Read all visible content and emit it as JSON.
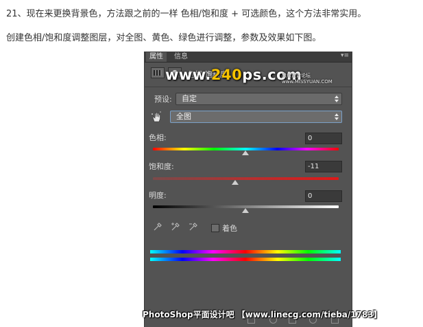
{
  "article": {
    "line1": "21、现在来更换背景色，方法跟之前的一样 色相/饱和度 + 可选颜色，这个方法非常实用。",
    "line2": "创建色相/饱和度调整图层，对全图、黄色、绿色进行调整，参数及效果如下图。"
  },
  "panel": {
    "tabs": [
      "属性",
      "信息"
    ],
    "menu_glyph": "▾≡",
    "title": "色相/饱和度",
    "preset_label": "预设:",
    "preset_value": "自定",
    "range_value": "全图",
    "hue_label": "色相:",
    "hue_value": "0",
    "saturation_label": "饱和度:",
    "saturation_value": "-11",
    "lightness_label": "明度:",
    "lightness_value": "0",
    "colorize_label": "着色"
  },
  "watermark": {
    "prefix": "www.",
    "number": "240",
    "suffix": "ps.com",
    "sub": "思缘设计论坛 www.MISSYUAN.COM"
  },
  "footer_watermark": "PhotoShop平面设计吧 【www.linecg.com/tieba/1783】"
}
